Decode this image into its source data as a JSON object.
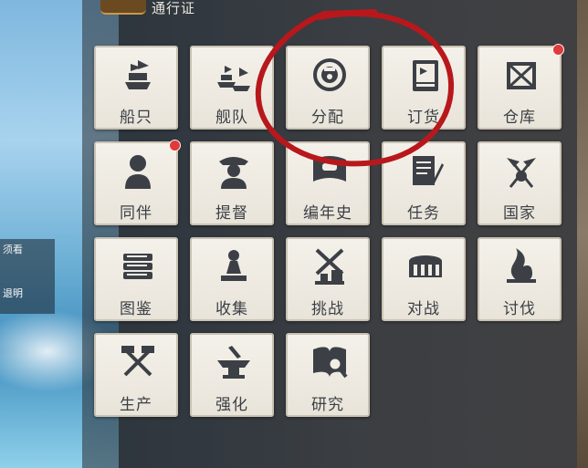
{
  "header": {
    "title": "通行证"
  },
  "side_panel": {
    "line1": "须看",
    "line2": "",
    "line3": "退明"
  },
  "menu": {
    "items": [
      {
        "label": "船只",
        "icon": "ship-icon",
        "badge": false
      },
      {
        "label": "舰队",
        "icon": "fleet-icon",
        "badge": false
      },
      {
        "label": "分配",
        "icon": "allocate-icon",
        "badge": false
      },
      {
        "label": "订货",
        "icon": "order-icon",
        "badge": false
      },
      {
        "label": "仓库",
        "icon": "warehouse-icon",
        "badge": true
      },
      {
        "label": "同伴",
        "icon": "companion-icon",
        "badge": true
      },
      {
        "label": "提督",
        "icon": "admiral-icon",
        "badge": false
      },
      {
        "label": "编年史",
        "icon": "chronicle-icon",
        "badge": false
      },
      {
        "label": "任务",
        "icon": "quest-icon",
        "badge": false
      },
      {
        "label": "国家",
        "icon": "nation-icon",
        "badge": false
      },
      {
        "label": "图鉴",
        "icon": "encyclopedia-icon",
        "badge": false
      },
      {
        "label": "收集",
        "icon": "collection-icon",
        "badge": false
      },
      {
        "label": "挑战",
        "icon": "challenge-icon",
        "badge": false
      },
      {
        "label": "对战",
        "icon": "arena-icon",
        "badge": false
      },
      {
        "label": "讨伐",
        "icon": "subjugation-icon",
        "badge": false
      },
      {
        "label": "生产",
        "icon": "production-icon",
        "badge": false
      },
      {
        "label": "强化",
        "icon": "enhance-icon",
        "badge": false
      },
      {
        "label": "研究",
        "icon": "research-icon",
        "badge": false
      }
    ]
  },
  "colors": {
    "tile_bg": "#f1ede5",
    "label": "#3b3f44",
    "icon": "#3c4046",
    "badge": "#e03a3a",
    "annotation": "#b8181c"
  }
}
